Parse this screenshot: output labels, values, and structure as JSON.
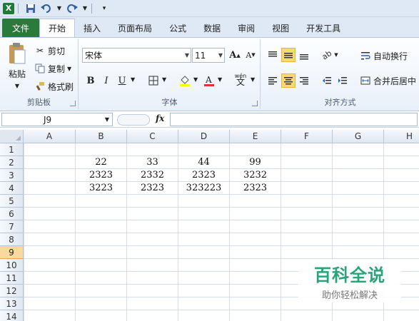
{
  "qat": {
    "logo_letter": "X",
    "save_icon": "save-icon",
    "undo_icon": "undo-icon",
    "redo_icon": "redo-icon",
    "customize_icon": "customize-icon"
  },
  "tabs": [
    "文件",
    "开始",
    "插入",
    "页面布局",
    "公式",
    "数据",
    "审阅",
    "视图",
    "开发工具"
  ],
  "clipboard": {
    "paste": "粘贴",
    "cut": "剪切",
    "copy": "复制",
    "format_painter": "格式刷",
    "label": "剪贴板"
  },
  "font": {
    "name": "宋体",
    "size": "11",
    "label": "字体",
    "bold": "B",
    "italic": "I",
    "underline": "U",
    "grow": "A",
    "shrink": "A",
    "wen": "wén"
  },
  "alignment": {
    "wrap": "自动换行",
    "merge": "合并后居中",
    "label": "对齐方式"
  },
  "formula_bar": {
    "name_box": "J9",
    "fx": "fx",
    "value": ""
  },
  "columns": [
    "A",
    "B",
    "C",
    "D",
    "E",
    "F",
    "G",
    "H"
  ],
  "rows": [
    "1",
    "2",
    "3",
    "4",
    "5",
    "6",
    "7",
    "8",
    "9",
    "10",
    "11",
    "12",
    "13",
    "14"
  ],
  "selected_row": "9",
  "cells": {
    "B2": "22",
    "C2": "33",
    "D2": "44",
    "E2": "99",
    "B3": "2323",
    "C3": "2332",
    "D3": "2323",
    "E3": "3232",
    "B4": "3223",
    "C4": "2323",
    "D4": "323223",
    "E4": "2323"
  },
  "watermark": {
    "title": "百科全说",
    "subtitle": "助你轻松解决"
  },
  "colors": {
    "file_tab": "#2a7a3c",
    "row_select": "#f9d99e",
    "watermark": "#2aa37a"
  }
}
